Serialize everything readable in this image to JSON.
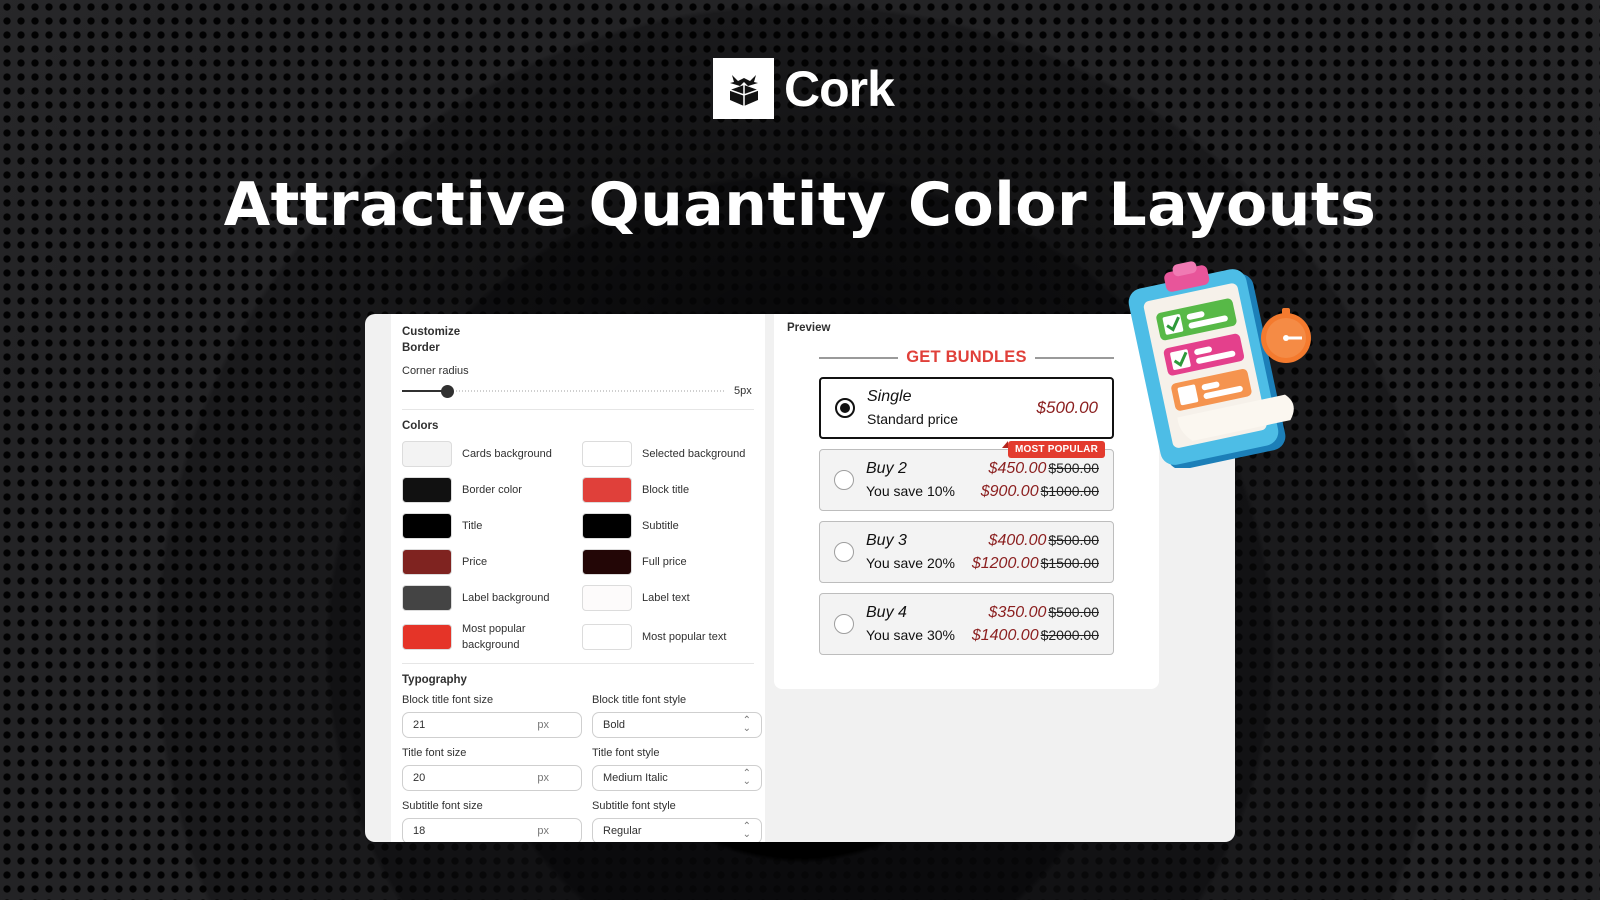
{
  "brand": {
    "name": "Cork",
    "logo_icon": "box-arrows-icon"
  },
  "headline": "Attractive Quantity Color Layouts",
  "settings": {
    "title": "Customize",
    "border_section": "Border",
    "corner_radius_label": "Corner radius",
    "corner_radius_value": "5px",
    "corner_radius_fraction": 0.14,
    "colors_section": "Colors",
    "colors": [
      {
        "label": "Cards background",
        "color": "#f3f3f3"
      },
      {
        "label": "Selected background",
        "color": "#ffffff"
      },
      {
        "label": "Border color",
        "color": "#111111"
      },
      {
        "label": "Block title",
        "color": "#e0403a"
      },
      {
        "label": "Title",
        "color": "#000000"
      },
      {
        "label": "Subtitle",
        "color": "#000000"
      },
      {
        "label": "Price",
        "color": "#7f2320"
      },
      {
        "label": "Full price",
        "color": "#230606"
      },
      {
        "label": "Label background",
        "color": "#444444"
      },
      {
        "label": "Label text",
        "color": "#fdfbfb"
      },
      {
        "label": "Most popular background",
        "color": "#e53428"
      },
      {
        "label": "Most popular text",
        "color": "#ffffff"
      }
    ],
    "typography_section": "Typography",
    "typography": [
      {
        "label": "Block title font size",
        "value": "21",
        "unit": "px",
        "type": "number"
      },
      {
        "label": "Block title font style",
        "value": "Bold",
        "type": "select"
      },
      {
        "label": "Title font size",
        "value": "20",
        "unit": "px",
        "type": "number"
      },
      {
        "label": "Title font style",
        "value": "Medium Italic",
        "type": "select"
      },
      {
        "label": "Subtitle font size",
        "value": "18",
        "unit": "px",
        "type": "number"
      },
      {
        "label": "Subtitle font style",
        "value": "Regular",
        "type": "select"
      }
    ]
  },
  "preview": {
    "label": "Preview",
    "block_title": "GET BUNDLES",
    "options": [
      {
        "title": "Single",
        "subtitle": "Standard price",
        "selected": true,
        "badge": null,
        "prices": [
          {
            "price": "$500.00",
            "full": null
          }
        ]
      },
      {
        "title": "Buy 2",
        "subtitle": "You save 10%",
        "selected": false,
        "badge": "MOST POPULAR",
        "prices": [
          {
            "price": "$450.00",
            "full": "$500.00"
          },
          {
            "price": "$900.00",
            "full": "$1000.00"
          }
        ]
      },
      {
        "title": "Buy 3",
        "subtitle": "You save 20%",
        "selected": false,
        "badge": null,
        "prices": [
          {
            "price": "$400.00",
            "full": "$500.00"
          },
          {
            "price": "$1200.00",
            "full": "$1500.00"
          }
        ]
      },
      {
        "title": "Buy 4",
        "subtitle": "You save 30%",
        "selected": false,
        "badge": null,
        "prices": [
          {
            "price": "$350.00",
            "full": "$500.00"
          },
          {
            "price": "$1400.00",
            "full": "$2000.00"
          }
        ]
      }
    ]
  },
  "illustration": {
    "icon": "clipboard-checklist-icon",
    "accessory_icon": "stopwatch-icon"
  }
}
